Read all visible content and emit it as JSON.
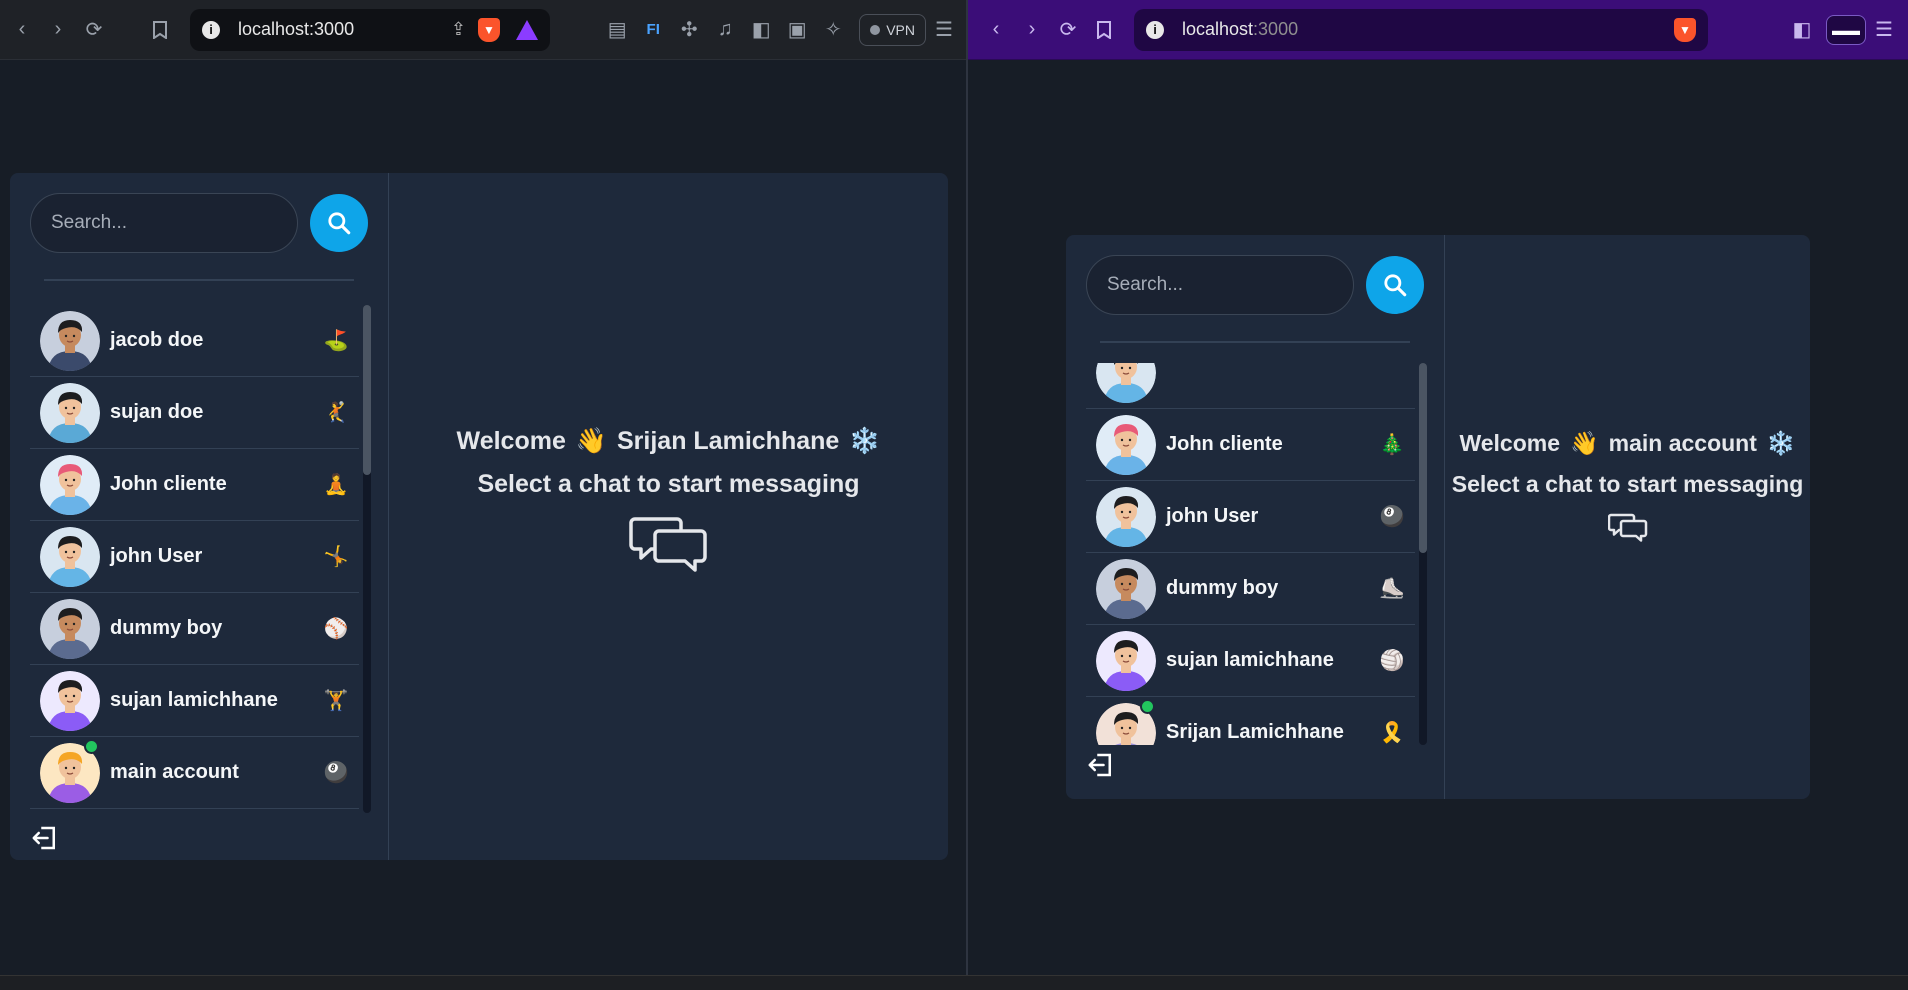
{
  "left_window": {
    "address": "localhost:3000",
    "vpn_label": "VPN",
    "search": {
      "placeholder": "Search..."
    },
    "users": [
      {
        "name": "jacob doe",
        "emoji": "⛳",
        "skin": "#c68a5e",
        "hair": "#1d1d1f",
        "shirt": "#3b4a6b",
        "bg": "#c7cfdd"
      },
      {
        "name": "sujan doe",
        "emoji": "🤾",
        "skin": "#f0c29c",
        "hair": "#1d1d1f",
        "shirt": "#5aa9d6",
        "bg": "#d9e6f1"
      },
      {
        "name": "John cliente",
        "emoji": "🧘",
        "skin": "#f0c29c",
        "hair": "#e85a78",
        "shirt": "#6ab3e8",
        "bg": "#e0ecf7"
      },
      {
        "name": "john User",
        "emoji": "🤸",
        "skin": "#f0c29c",
        "hair": "#1d1d1f",
        "shirt": "#64b5e6",
        "bg": "#d9e6f1"
      },
      {
        "name": "dummy boy",
        "emoji": "⚾",
        "skin": "#c68a5e",
        "hair": "#1d1d1f",
        "shirt": "#5b6b8f",
        "bg": "#c7cfdd"
      },
      {
        "name": "sujan lamichhane",
        "emoji": "🏋️",
        "skin": "#f0c29c",
        "hair": "#1d1d1f",
        "shirt": "#8b5cf6",
        "bg": "#ede9fe"
      },
      {
        "name": "main account",
        "emoji": "🎱",
        "skin": "#f0c29c",
        "hair": "#f5a524",
        "shirt": "#9b5de5",
        "bg": "#fde7c2",
        "online": true
      }
    ],
    "welcome_prefix": "Welcome",
    "wave_emoji": "👋",
    "welcome_name": "Srijan Lamichhane",
    "snow_emoji": "❄️",
    "subtitle": "Select a chat to start messaging"
  },
  "right_window": {
    "address_host": "localhost",
    "address_port": ":3000",
    "search": {
      "placeholder": "Search..."
    },
    "users": [
      {
        "name": "",
        "emoji": "",
        "skin": "#f0c29c",
        "hair": "#1d1d1f",
        "shirt": "#64b5e6",
        "bg": "#d9e6f1"
      },
      {
        "name": "John cliente",
        "emoji": "🎄",
        "skin": "#f0c29c",
        "hair": "#e85a78",
        "shirt": "#6ab3e8",
        "bg": "#e0ecf7"
      },
      {
        "name": "john User",
        "emoji": "🎱",
        "skin": "#f0c29c",
        "hair": "#1d1d1f",
        "shirt": "#64b5e6",
        "bg": "#d9e6f1"
      },
      {
        "name": "dummy boy",
        "emoji": "⛸️",
        "skin": "#c68a5e",
        "hair": "#1d1d1f",
        "shirt": "#5b6b8f",
        "bg": "#c7cfdd"
      },
      {
        "name": "sujan lamichhane",
        "emoji": "🏐",
        "skin": "#f0c29c",
        "hair": "#1d1d1f",
        "shirt": "#8b5cf6",
        "bg": "#ede9fe"
      },
      {
        "name": "Srijan Lamichhane",
        "emoji": "🎗️",
        "skin": "#f0c29c",
        "hair": "#1d1d1f",
        "shirt": "#9b8fd9",
        "bg": "#f2e1d8",
        "online": true
      }
    ],
    "welcome_prefix": "Welcome",
    "wave_emoji": "👋",
    "welcome_name": "main account",
    "snow_emoji": "❄️",
    "subtitle": "Select a chat to start messaging"
  },
  "colors": {
    "accent": "#0ea5e9",
    "card": "#1e293b",
    "online": "#22c55e"
  }
}
